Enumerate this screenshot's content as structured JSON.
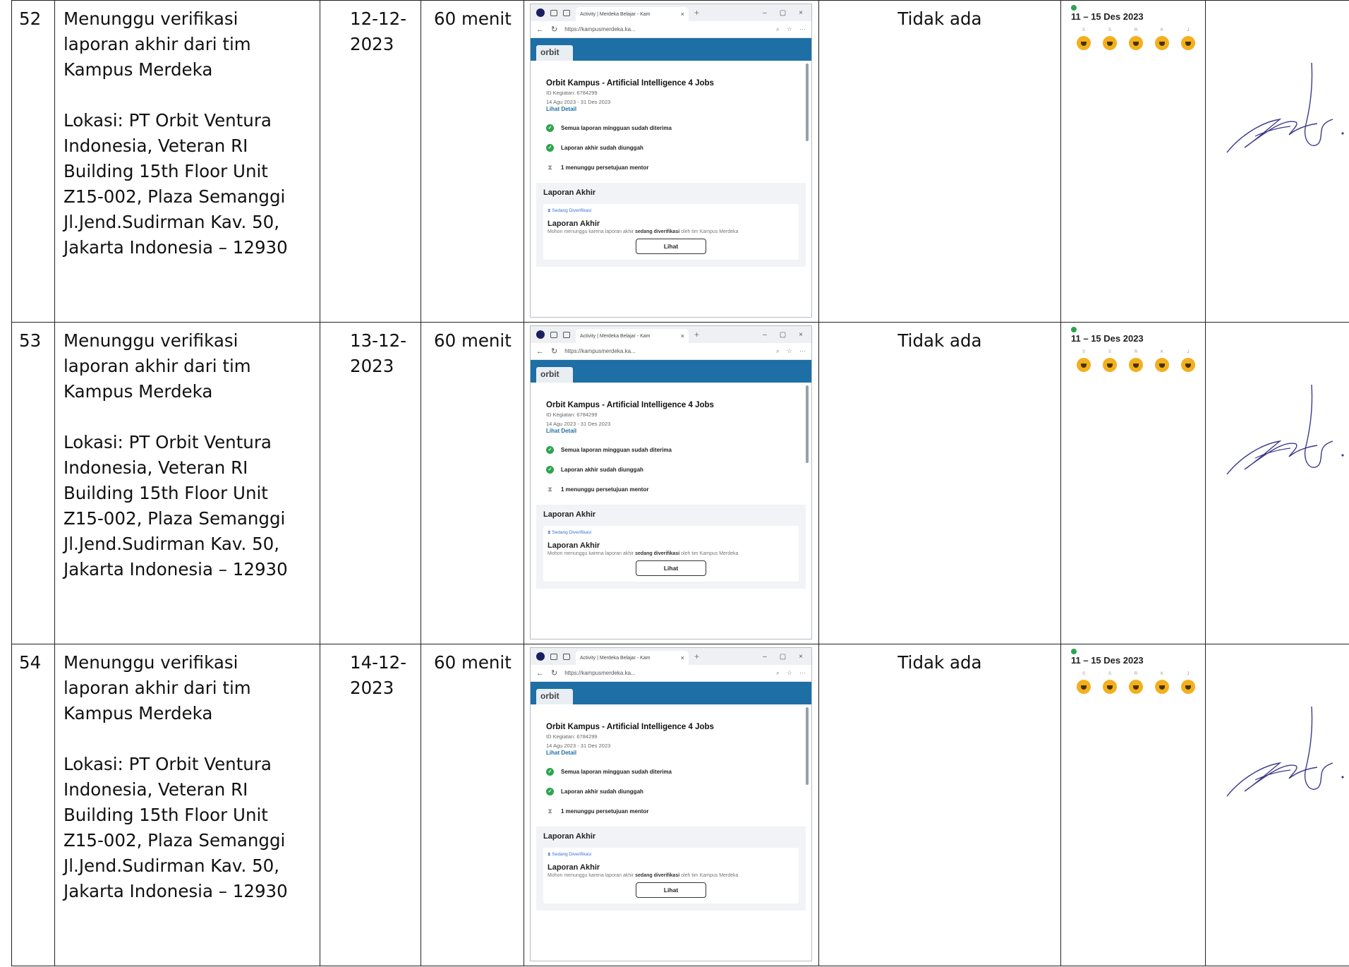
{
  "rows": [
    {
      "no": "52",
      "activity_lines": [
        "Menunggu verifikasi",
        "laporan akhir dari tim",
        "Kampus Merdeka"
      ],
      "location_lines": [
        "Lokasi: PT Orbit Ventura",
        "Indonesia, Veteran RI",
        "Building 15th Floor Unit",
        "Z15-002, Plaza Semanggi",
        "Jl.Jend.Sudirman Kav. 50,",
        "Jakarta Indonesia – 12930"
      ],
      "date_lines": [
        "12-12-",
        "2023"
      ],
      "duration": "60 menit",
      "kendala": "Tidak ada"
    },
    {
      "no": "53",
      "activity_lines": [
        "Menunggu verifikasi",
        "laporan akhir dari tim",
        "Kampus Merdeka"
      ],
      "location_lines": [
        "Lokasi: PT Orbit Ventura",
        "Indonesia, Veteran RI",
        "Building 15th Floor Unit",
        "Z15-002, Plaza Semanggi",
        "Jl.Jend.Sudirman Kav. 50,",
        "Jakarta Indonesia – 12930"
      ],
      "date_lines": [
        "13-12-",
        "2023"
      ],
      "duration": "60 menit",
      "kendala": "Tidak ada"
    },
    {
      "no": "54",
      "activity_lines": [
        "Menunggu verifikasi",
        "laporan akhir dari tim",
        "Kampus Merdeka"
      ],
      "location_lines": [
        "Lokasi: PT Orbit Ventura",
        "Indonesia, Veteran RI",
        "Building 15th Floor Unit",
        "Z15-002, Plaza Semanggi",
        "Jl.Jend.Sudirman Kav. 50,",
        "Jakarta Indonesia – 12930"
      ],
      "date_lines": [
        "14-12-",
        "2023"
      ],
      "duration": "60 menit",
      "kendala": "Tidak ada"
    }
  ],
  "screenshot": {
    "tab_title": "Activity | Merdeka Belajar - Kam",
    "url": "https://kampusmerdeka.ka...",
    "logo_text": "orbit",
    "job_title": "Orbit Kampus - Artificial Intelligence 4 Jobs",
    "activity_id": "ID Kegiatan: 6784299",
    "period": "14 Agu 2023 - 31 Des 2023",
    "detail_link": "Lihat Detail",
    "status_1": "Semua laporan mingguan sudah diterima",
    "status_2": "Laporan akhir sudah diunggah",
    "status_3": "1 menunggu persetujuan mentor",
    "report_heading": "Laporan Akhir",
    "badge": "Sedang Diverifikasi",
    "card_title": "Laporan Akhir",
    "card_desc_prefix": "Mohon menunggu karena laporan akhir ",
    "card_desc_bold": "sedang diverifikasi",
    "card_desc_suffix": " oleh tim Kampus Merdeka",
    "button_label": "Lihat",
    "icons": [
      "browser-logo-icon",
      "back-icon",
      "refresh-icon",
      "check-circle-icon",
      "hourglass-icon"
    ]
  },
  "calendar": {
    "range": "11 – 15 Des 2023",
    "days": [
      "S",
      "S",
      "R",
      "K",
      "J"
    ],
    "mood_color": "#f2b01e"
  }
}
